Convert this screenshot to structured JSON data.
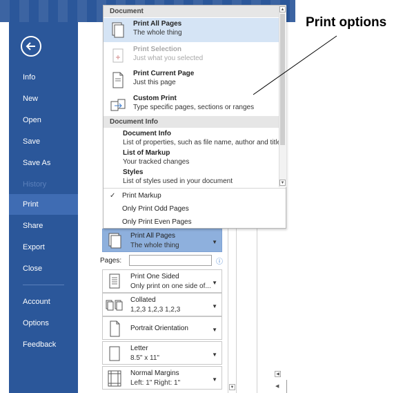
{
  "callout": {
    "label": "Print options"
  },
  "sidebar": {
    "items": [
      {
        "label": "Info"
      },
      {
        "label": "New"
      },
      {
        "label": "Open"
      },
      {
        "label": "Save"
      },
      {
        "label": "Save As"
      },
      {
        "label": "History"
      },
      {
        "label": "Print"
      },
      {
        "label": "Share"
      },
      {
        "label": "Export"
      },
      {
        "label": "Close"
      },
      {
        "label": "Account"
      },
      {
        "label": "Options"
      },
      {
        "label": "Feedback"
      }
    ]
  },
  "dropdown": {
    "document_header": "Document",
    "items": [
      {
        "title": "Print All Pages",
        "desc": "The whole thing"
      },
      {
        "title": "Print Selection",
        "desc": "Just what you selected"
      },
      {
        "title": "Print Current Page",
        "desc": "Just this page"
      },
      {
        "title": "Custom Print",
        "desc": "Type specific pages, sections or ranges"
      }
    ],
    "info_header": "Document Info",
    "info_items": [
      {
        "title": "Document Info",
        "desc": "List of properties, such as file name, author and title"
      },
      {
        "title": "List of Markup",
        "desc": "Your tracked changes"
      },
      {
        "title": "Styles",
        "desc": "List of styles used in your document"
      }
    ],
    "options": [
      {
        "label": "Print Markup",
        "checked": true
      },
      {
        "label": "Only Print Odd Pages",
        "checked": false
      },
      {
        "label": "Only Print Even Pages",
        "checked": false
      }
    ],
    "check_glyph": "✓"
  },
  "settings": {
    "print_range": {
      "title": "Print All Pages",
      "desc": "The whole thing"
    },
    "pages_label": "Pages:",
    "pages_value": "",
    "info_glyph": "ⓘ",
    "sides": {
      "title": "Print One Sided",
      "desc": "Only print on one side of..."
    },
    "collation": {
      "title": "Collated",
      "desc": "1,2,3   1,2,3   1,2,3"
    },
    "orientation": {
      "title": "Portrait Orientation"
    },
    "paper": {
      "title": "Letter",
      "desc": "8.5\" x 11\""
    },
    "margins": {
      "title": "Normal Margins",
      "desc": "Left: 1\"   Right: 1\""
    }
  },
  "colors": {
    "sidebar": "#2b579a",
    "active": "#3f6cb3",
    "selected_box": "#8eb0dd"
  }
}
